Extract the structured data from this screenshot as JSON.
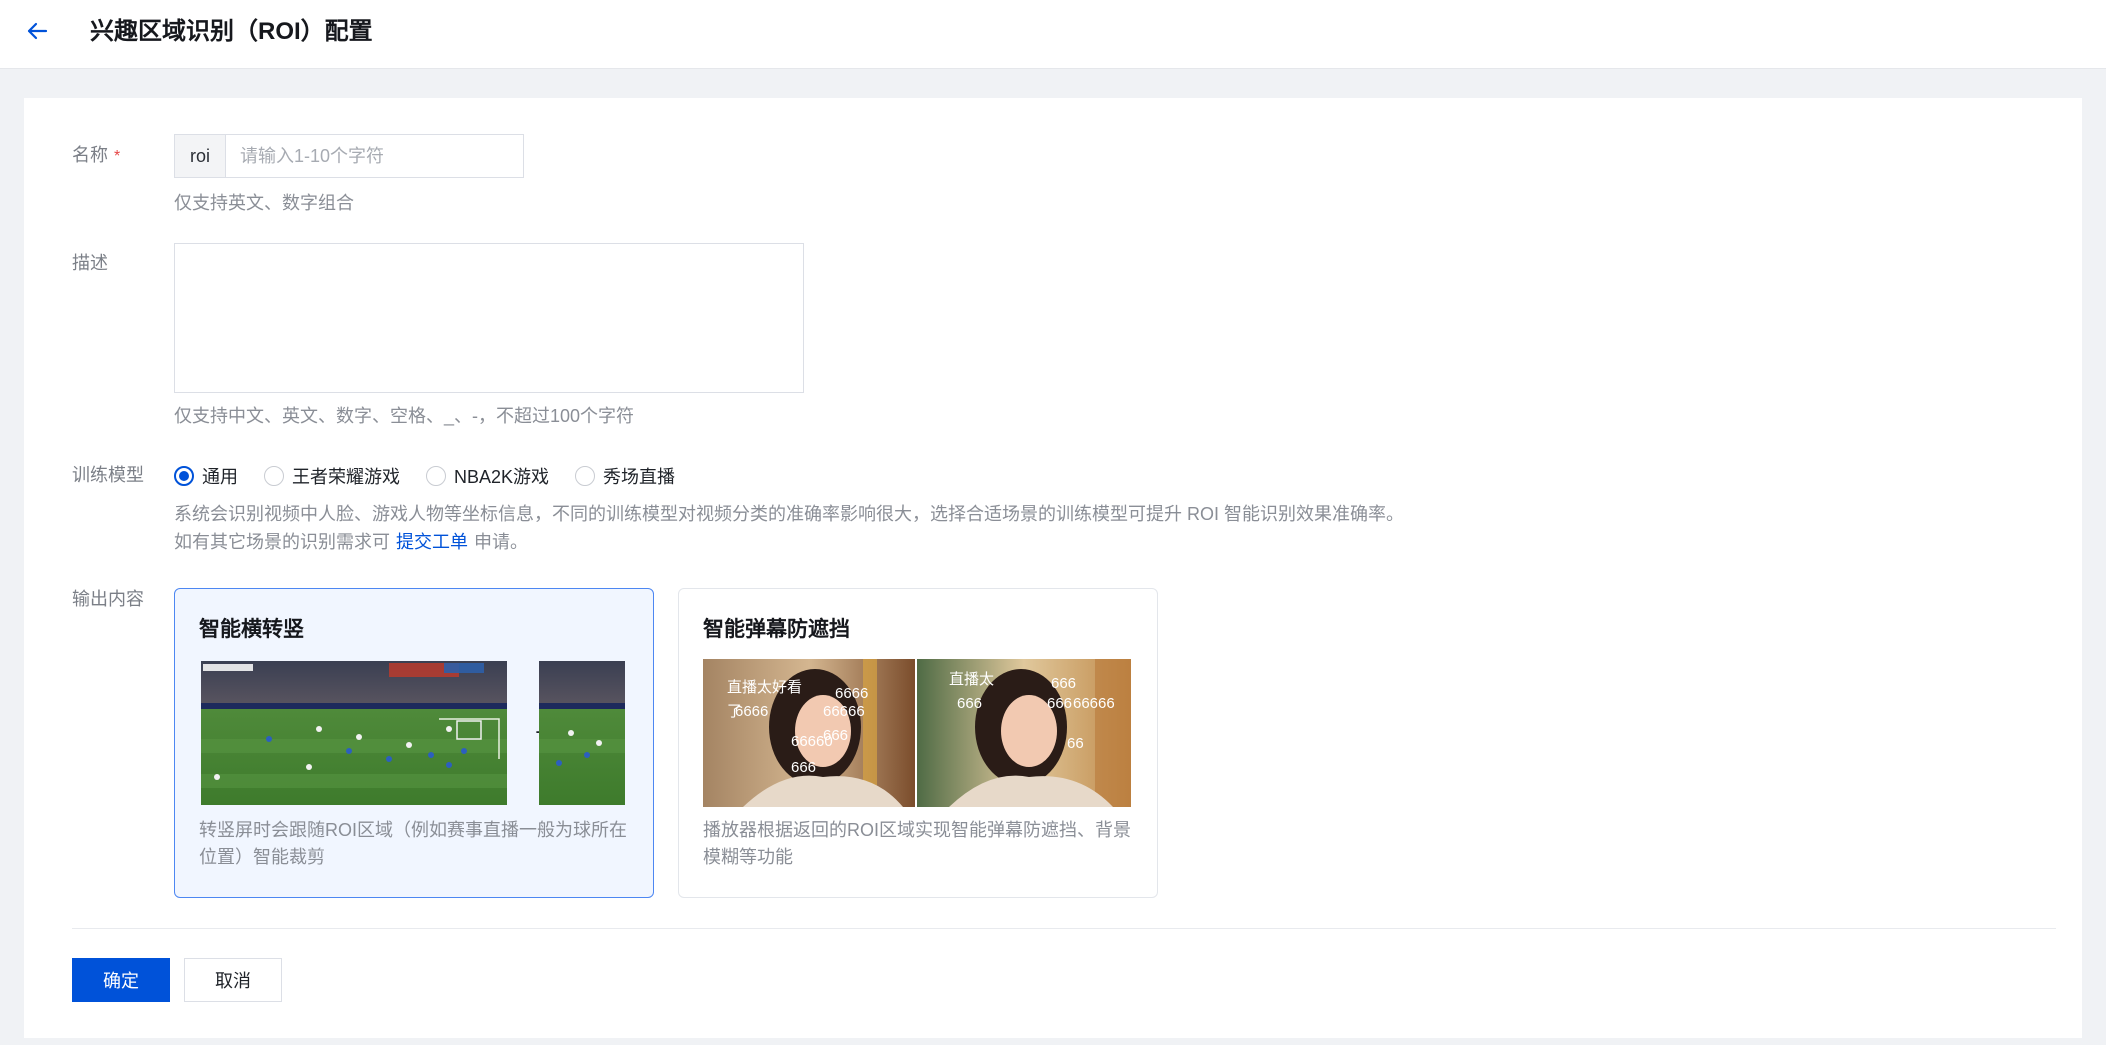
{
  "header": {
    "title": "兴趣区域识别（ROI）配置",
    "back_icon": "arrow-left-icon"
  },
  "form": {
    "name": {
      "label": "名称",
      "required_mark": "*",
      "prefix": "roi",
      "value": "",
      "placeholder": "请输入1-10个字符",
      "hint": "仅支持英文、数字组合"
    },
    "description": {
      "label": "描述",
      "value": "",
      "hint": "仅支持中文、英文、数字、空格、_、-，不超过100个字符"
    },
    "model": {
      "label": "训练模型",
      "selected": "通用",
      "options": [
        "通用",
        "王者荣耀游戏",
        "NBA2K游戏",
        "秀场直播"
      ],
      "desc_line1": "系统会识别视频中人脸、游戏人物等坐标信息，不同的训练模型对视频分类的准确率影响很大，选择合适场景的训练模型可提升 ROI 智能识别效果准确率。",
      "desc_line2_prefix": "如有其它场景的识别需求可",
      "desc_link": "提交工单",
      "desc_line2_suffix": "申请。"
    },
    "output": {
      "label": "输出内容",
      "cards": [
        {
          "title": "智能横转竖",
          "desc": "转竖屏时会跟随ROI区域（例如赛事直播一般为球所在位置）智能裁剪",
          "selected": true,
          "arrow": "→"
        },
        {
          "title": "智能弹幕防遮挡",
          "desc": "播放器根据返回的ROI区域实现智能弹幕防遮挡、背景模糊等功能",
          "selected": false,
          "danmaku_left": [
            "直播太好看",
            "6666",
            "6666",
            "66666",
            "66660",
            "666",
            "666",
            "了"
          ],
          "danmaku_right": [
            "直播太",
            "666",
            "666",
            "666",
            "66666",
            "66"
          ]
        }
      ]
    }
  },
  "actions": {
    "confirm": "确定",
    "cancel": "取消"
  },
  "colors": {
    "primary": "#0052d9",
    "page_bg": "#f0f2f5",
    "selected_card_bg": "#f1f6ff",
    "selected_card_border": "#4d87f2",
    "required": "#e54545"
  }
}
